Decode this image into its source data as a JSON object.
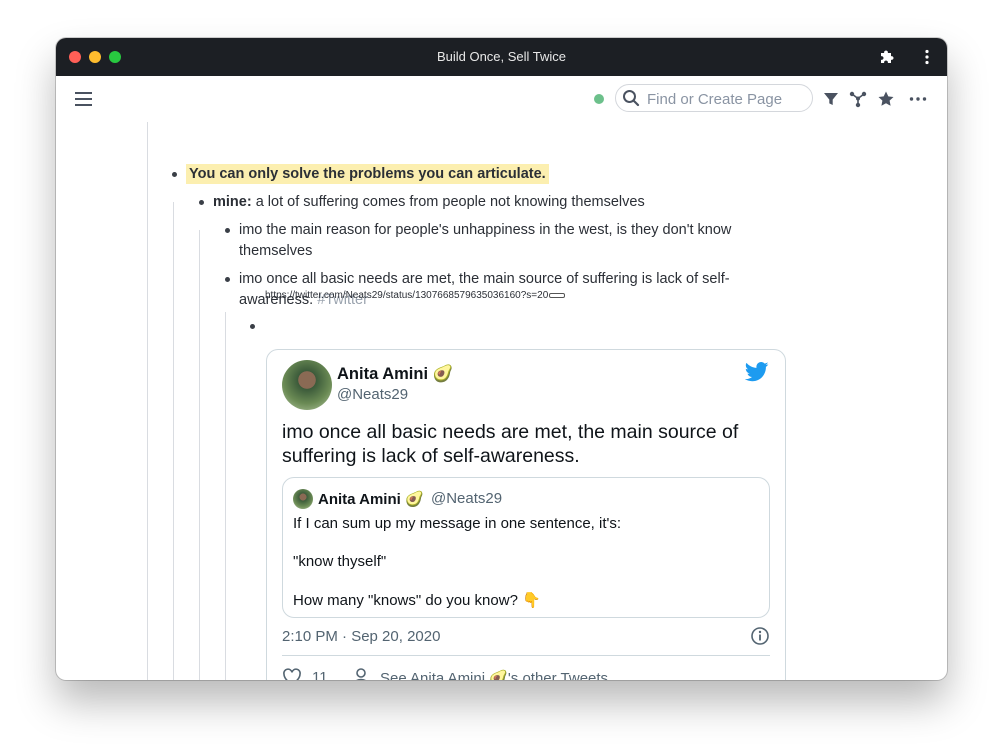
{
  "window": {
    "title": "Build Once, Sell Twice"
  },
  "toolbar": {
    "search_placeholder": "Find or Create Page"
  },
  "outline": {
    "block1": "You can only solve the problems you can articulate.",
    "block2_label": "mine:",
    "block2_text": " a lot of suffering comes from people not knowing themselves",
    "block3": "imo the main reason for people's unhappiness in the west, is they don't know themselves",
    "block4_text": "imo once all basic needs are met, the main source of suffering is lack of self-awareness. ",
    "block4_tag": "#Twitter",
    "url": "https://twitter.com/Neats29/status/1307668579635036160?s=20"
  },
  "tweet": {
    "name": "Anita Amini 🥑",
    "handle": "@Neats29",
    "text": "imo once all basic needs are met, the main source of suffering is lack of self-awareness.",
    "quote": {
      "name": "Anita Amini 🥑",
      "handle": "@Neats29",
      "line1": "If I can sum up my message in one sentence, it's:",
      "line2": "\"know thyself\"",
      "line3": "How many \"knows\" do you know? 👇"
    },
    "timestamp": "2:10 PM · Sep 20, 2020",
    "likes": "11",
    "see_more": "See Anita Amini 🥑's other Tweets"
  },
  "colors": {
    "titlebar": "#1c1f24",
    "highlight": "#fcefb0",
    "twitter_blue": "#1d9bf0",
    "status_green": "#6cc08b"
  }
}
